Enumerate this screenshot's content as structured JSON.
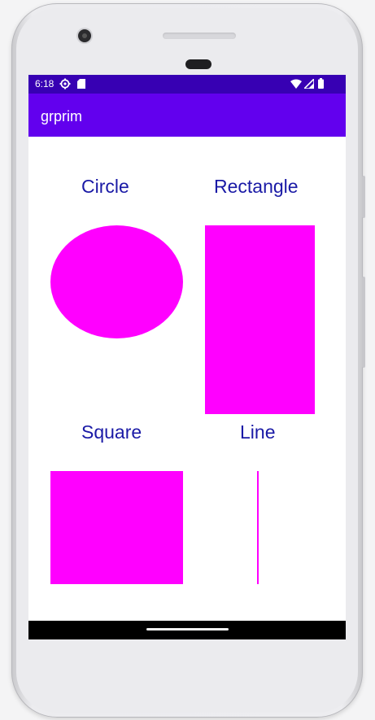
{
  "status_bar": {
    "time": "6:18",
    "left_icons": [
      "settings-gear-icon",
      "sd-card-icon"
    ],
    "right_icons": [
      "wifi-icon",
      "cellular-signal-icon",
      "battery-icon"
    ],
    "color": "#3700b3"
  },
  "app_bar": {
    "title": "grprim",
    "color": "#6200ee"
  },
  "shapes": {
    "fill_color": "#ff00ff",
    "label_color": "#1a1aa6",
    "circle": {
      "label": "Circle"
    },
    "rectangle": {
      "label": "Rectangle"
    },
    "square": {
      "label": "Square"
    },
    "line": {
      "label": "Line"
    }
  },
  "nav_bar": {
    "color": "#000000",
    "home_indicator": "home-pill"
  }
}
